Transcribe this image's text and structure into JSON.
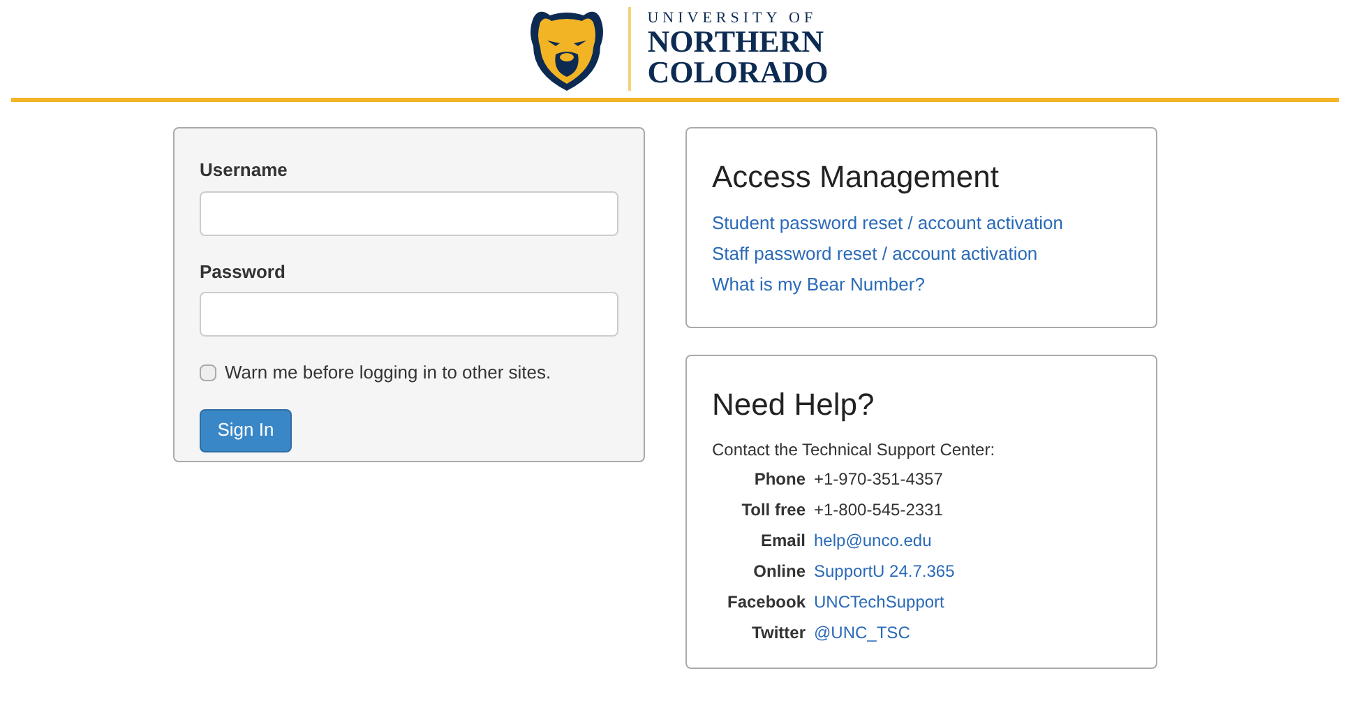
{
  "header": {
    "logo_line_1": "UNIVERSITY OF",
    "logo_line_2": "NORTHERN",
    "logo_line_3": "COLORADO"
  },
  "login": {
    "username_label": "Username",
    "password_label": "Password",
    "warn": {
      "label": "Warn me before logging in to other sites.",
      "checked": false
    },
    "submit": "Sign In"
  },
  "access": {
    "title": "Access Management",
    "links": [
      "Student password reset / account activation",
      "Staff password reset / account activation",
      "What is my Bear Number?"
    ]
  },
  "help": {
    "title": "Need Help?",
    "intro": "Contact the Technical Support Center:",
    "contacts": [
      {
        "label": "Phone",
        "value": "+1-970-351-4357",
        "kind": "text"
      },
      {
        "label": "Toll free",
        "value": "+1-800-545-2331",
        "kind": "text"
      },
      {
        "label": "Email",
        "value": "help@unco.edu",
        "kind": "link"
      },
      {
        "label": "Online",
        "value": "SupportU 24.7.365",
        "kind": "link"
      },
      {
        "label": "Facebook",
        "value": "UNCTechSupport",
        "kind": "link"
      },
      {
        "label": "Twitter",
        "value": "@UNC_TSC",
        "kind": "link"
      }
    ]
  }
}
